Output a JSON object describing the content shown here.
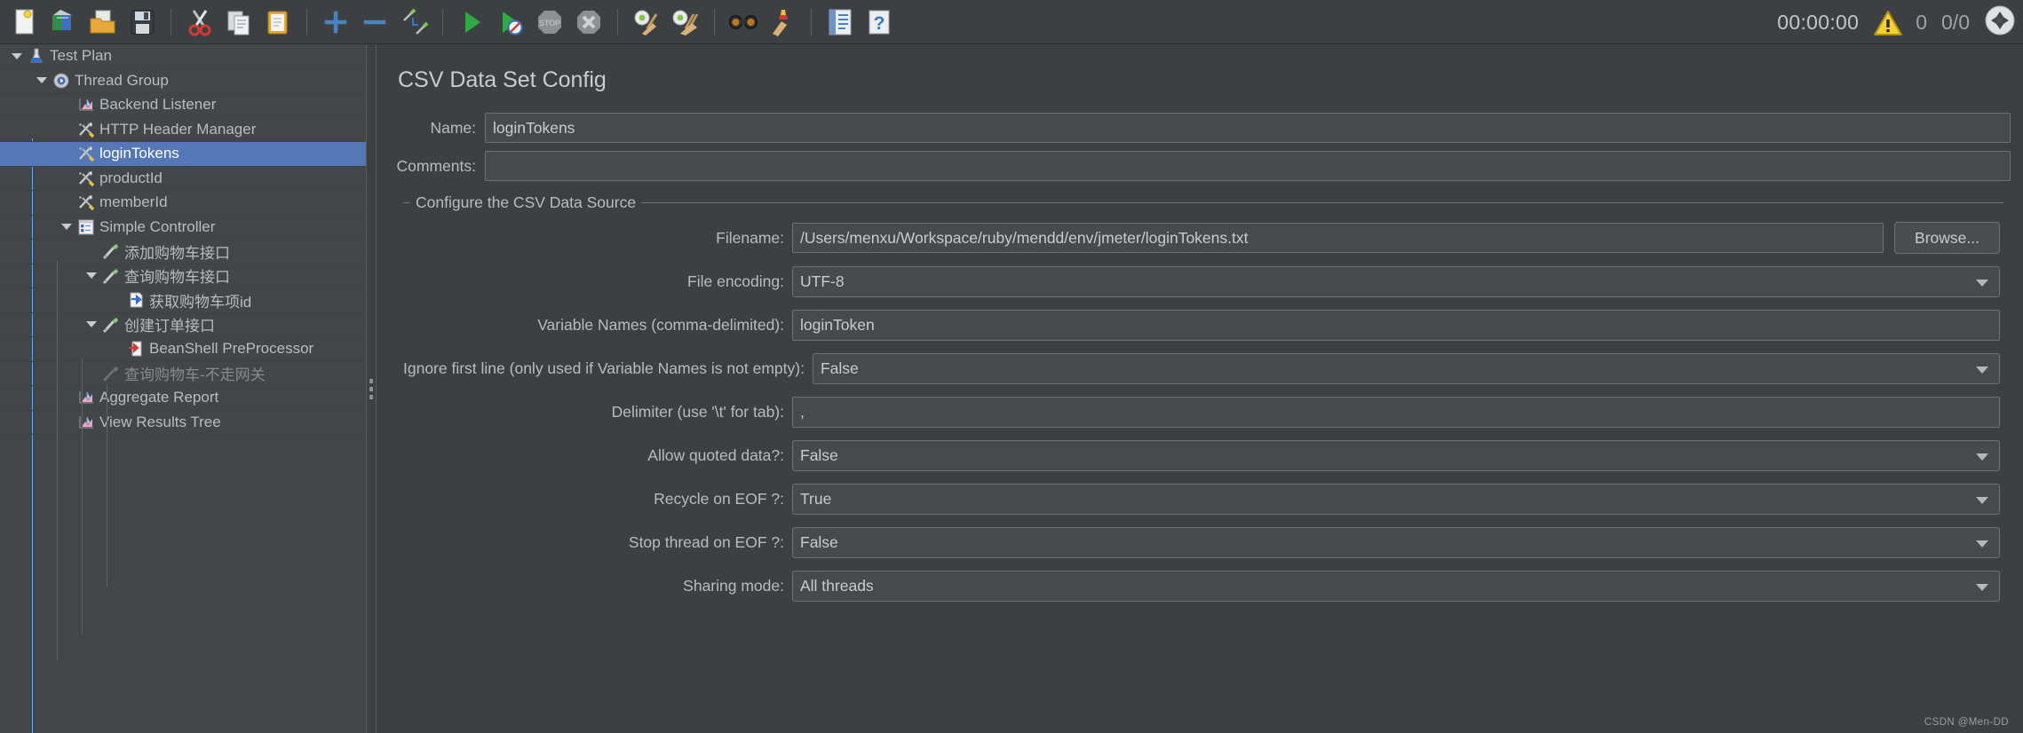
{
  "toolbar": {
    "buttons": [
      {
        "name": "new-icon",
        "title": "New"
      },
      {
        "name": "templates-icon",
        "title": "Templates"
      },
      {
        "name": "open-icon",
        "title": "Open"
      },
      {
        "name": "save-icon",
        "title": "Save Test Plan"
      },
      {
        "name": "cut-icon",
        "title": "Cut"
      },
      {
        "name": "copy-icon",
        "title": "Copy"
      },
      {
        "name": "paste-icon",
        "title": "Paste"
      },
      {
        "name": "expand-all-icon",
        "title": "Expand All"
      },
      {
        "name": "collapse-all-icon",
        "title": "Collapse All"
      },
      {
        "name": "toggle-icon",
        "title": "Toggle"
      },
      {
        "name": "start-icon",
        "title": "Start"
      },
      {
        "name": "start-no-pauses-icon",
        "title": "Start no pauses"
      },
      {
        "name": "stop-icon",
        "title": "Stop"
      },
      {
        "name": "shutdown-icon",
        "title": "Shutdown"
      },
      {
        "name": "clear-icon",
        "title": "Clear"
      },
      {
        "name": "clear-all-icon",
        "title": "Clear All"
      },
      {
        "name": "search-icon",
        "title": "Search"
      },
      {
        "name": "reset-search-icon",
        "title": "Reset Search"
      },
      {
        "name": "function-helper-icon",
        "title": "Function Helper Dialog"
      },
      {
        "name": "help-icon",
        "title": "Help"
      }
    ],
    "status": {
      "elapsed_time": "00:00:00",
      "warning_count": "0",
      "threads": "0/0"
    }
  },
  "tree": {
    "items": [
      {
        "label": "Test Plan",
        "indent": 0,
        "icon": "test-plan-icon",
        "twisty": true,
        "selected": false,
        "dim": false
      },
      {
        "label": "Thread Group",
        "indent": 1,
        "icon": "thread-group-icon",
        "twisty": true,
        "selected": false,
        "dim": false
      },
      {
        "label": "Backend Listener",
        "indent": 2,
        "icon": "listener-icon",
        "twisty": false,
        "selected": false,
        "dim": false
      },
      {
        "label": "HTTP Header Manager",
        "indent": 2,
        "icon": "config-element-icon",
        "twisty": false,
        "selected": false,
        "dim": false
      },
      {
        "label": "loginTokens",
        "indent": 2,
        "icon": "config-element-icon",
        "twisty": false,
        "selected": true,
        "dim": false
      },
      {
        "label": "productId",
        "indent": 2,
        "icon": "config-element-icon",
        "twisty": false,
        "selected": false,
        "dim": false
      },
      {
        "label": "memberId",
        "indent": 2,
        "icon": "config-element-icon",
        "twisty": false,
        "selected": false,
        "dim": false
      },
      {
        "label": "Simple Controller",
        "indent": 2,
        "icon": "controller-icon",
        "twisty": true,
        "selected": false,
        "dim": false
      },
      {
        "label": "添加购物车接口",
        "indent": 3,
        "icon": "sampler-icon",
        "twisty": false,
        "selected": false,
        "dim": false
      },
      {
        "label": "查询购物车接口",
        "indent": 3,
        "icon": "sampler-icon",
        "twisty": true,
        "selected": false,
        "dim": false
      },
      {
        "label": "获取购物车项id",
        "indent": 4,
        "icon": "post-processor-icon",
        "twisty": false,
        "selected": false,
        "dim": false
      },
      {
        "label": "创建订单接口",
        "indent": 3,
        "icon": "sampler-icon",
        "twisty": true,
        "selected": false,
        "dim": false
      },
      {
        "label": "BeanShell PreProcessor",
        "indent": 4,
        "icon": "pre-processor-icon",
        "twisty": false,
        "selected": false,
        "dim": false
      },
      {
        "label": "查询购物车-不走网关",
        "indent": 3,
        "icon": "sampler-disabled-icon",
        "twisty": false,
        "selected": false,
        "dim": true
      },
      {
        "label": "Aggregate Report",
        "indent": 2,
        "icon": "listener-icon",
        "twisty": false,
        "selected": false,
        "dim": false
      },
      {
        "label": "View Results Tree",
        "indent": 2,
        "icon": "listener-icon",
        "twisty": false,
        "selected": false,
        "dim": false
      }
    ]
  },
  "panel": {
    "title": "CSV Data Set Config",
    "name_label": "Name:",
    "name_value": "loginTokens",
    "comments_label": "Comments:",
    "comments_value": "",
    "group_title": "Configure the CSV Data Source",
    "browse_label": "Browse...",
    "fields": [
      {
        "label": "Filename:",
        "value": "/Users/menxu/Workspace/ruby/mendd/env/jmeter/loginTokens.txt",
        "type": "text-with-browse"
      },
      {
        "label": "File encoding:",
        "value": "UTF-8",
        "type": "combo"
      },
      {
        "label": "Variable Names (comma-delimited):",
        "value": "loginToken",
        "type": "text"
      },
      {
        "label": "Ignore first line (only used if Variable Names is not empty):",
        "value": "False",
        "type": "combo"
      },
      {
        "label": "Delimiter (use '\\t' for tab):",
        "value": ",",
        "type": "text"
      },
      {
        "label": "Allow quoted data?:",
        "value": "False",
        "type": "combo"
      },
      {
        "label": "Recycle on EOF ?:",
        "value": "True",
        "type": "combo"
      },
      {
        "label": "Stop thread on EOF ?:",
        "value": "False",
        "type": "combo"
      },
      {
        "label": "Sharing mode:",
        "value": "All threads",
        "type": "combo"
      }
    ]
  },
  "watermark": "CSDN @Men-DD",
  "colors": {
    "background": "#3c4043",
    "tree_background": "#434649",
    "selection": "#5577b5",
    "field_background": "#474a4d",
    "border": "#6d7174",
    "text": "#c9ccce",
    "accent_blue": "#6aa9e8"
  }
}
